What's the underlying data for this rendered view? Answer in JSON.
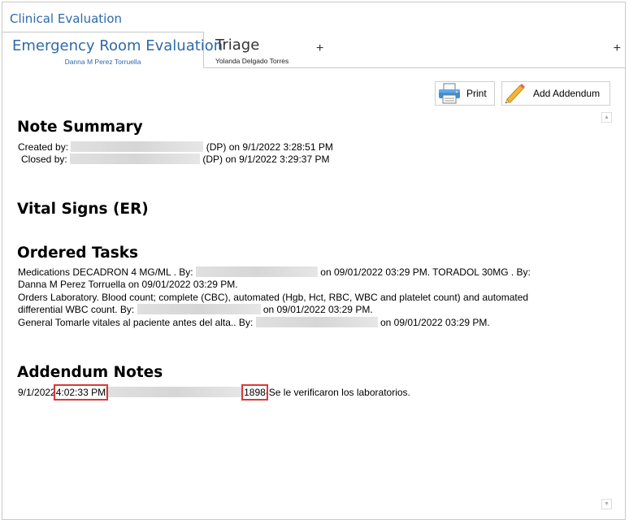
{
  "app": {
    "title": "Clinical Evaluation"
  },
  "tabs": [
    {
      "title": "Emergency Room Evaluation",
      "subtitle": "Danna M Perez Torruella"
    },
    {
      "title": "Triage",
      "subtitle": "Yolanda Delgado Torres"
    }
  ],
  "tab_add_glyph": "+",
  "toolbar": {
    "print_label": "Print",
    "addendum_label": "Add Addendum",
    "print_icon": "printer-icon",
    "addendum_icon": "pencil-icon"
  },
  "note_summary": {
    "heading": "Note Summary",
    "created_label": "Created by:",
    "created_suffix": "(DP) on 9/1/2022 3:28:51 PM",
    "closed_label": "Closed by:",
    "closed_suffix": "(DP) on 9/1/2022 3:29:37 PM"
  },
  "vital_signs": {
    "heading": "Vital Signs (ER)"
  },
  "ordered_tasks": {
    "heading": "Ordered Tasks",
    "line1_a": "Medications DECADRON 4 MG/ML . By:",
    "line1_b": "on 09/01/2022 03:29 PM. TORADOL 30MG . By:",
    "line2": "Danna M Perez Torruella on 09/01/2022 03:29 PM.",
    "line3": "Orders Laboratory. Blood count; complete (CBC), automated (Hgb, Hct, RBC, WBC and platelet count) and automated",
    "line4_a": "differential WBC count. By:",
    "line4_b": "on 09/01/2022 03:29 PM.",
    "line5_a": "General Tomarle vitales al paciente antes del alta.. By:",
    "line5_b": "on 09/01/2022 03:29 PM."
  },
  "addendum_notes": {
    "heading": "Addendum Notes",
    "date": "9/1/2022",
    "time": "4:02:33 PM",
    "code": "1898",
    "dash": "-",
    "text": "Se le verificaron los laboratorios."
  },
  "colors": {
    "accent": "#2e6aa8",
    "highlight": "#d93a3a",
    "border": "#c9c9c9"
  }
}
